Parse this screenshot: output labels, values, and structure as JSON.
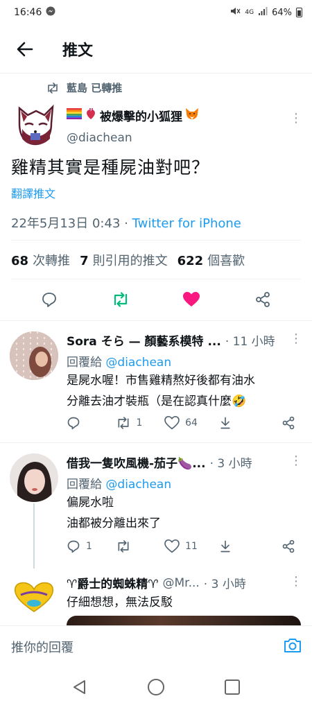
{
  "status_bar": {
    "time": "16:46",
    "battery": "64%",
    "signal_text": "4G"
  },
  "header": {
    "title": "推文"
  },
  "retweet_context": {
    "text": "藍島 已轉推"
  },
  "tweet": {
    "author_name": "被爆擊的小狐狸",
    "author_handle": "@diachean",
    "text": "雞精其實是種屍油對吧？",
    "translate_label": "翻譯推文",
    "timestamp": "22年5月13日 0:43 · ",
    "source": "Twitter for iPhone",
    "stats": {
      "retweets_count": "68",
      "retweets_label": "次轉推",
      "quotes_count": "7",
      "quotes_label": "則引用的推文",
      "likes_count": "622",
      "likes_label": "個喜歡"
    },
    "liked": true,
    "colors": {
      "like": "#f91880",
      "retweet": "#00ba7c",
      "link": "#1d9bf0"
    }
  },
  "replies": [
    {
      "name": "Sora そら — 顏藝系模特 ...",
      "time": "· 11 小時",
      "reply_to_label": "回覆給 ",
      "reply_to_handle": "@diachean",
      "lines": [
        "是屍水喔！市售雞精熬好後都有油水",
        "分離去油才裝瓶（是在認真什麼🤣"
      ],
      "replies_count": "",
      "retweets_count": "1",
      "likes_count": "64"
    },
    {
      "name": "借我一隻吹風機-茄子🍆...",
      "time": "· 3 小時",
      "reply_to_label": "回覆給 ",
      "reply_to_handle": "@diachean",
      "lines": [
        "偏屍水啦",
        "油都被分離出來了"
      ],
      "replies_count": "1",
      "retweets_count": "",
      "likes_count": "11"
    },
    {
      "name": "♈爵士的蜘蛛精♈",
      "handle": "@Mr...",
      "time": "· 3 小時",
      "lines": [
        "仔細想想，無法反駁"
      ]
    }
  ],
  "compose": {
    "placeholder": "推你的回覆"
  }
}
